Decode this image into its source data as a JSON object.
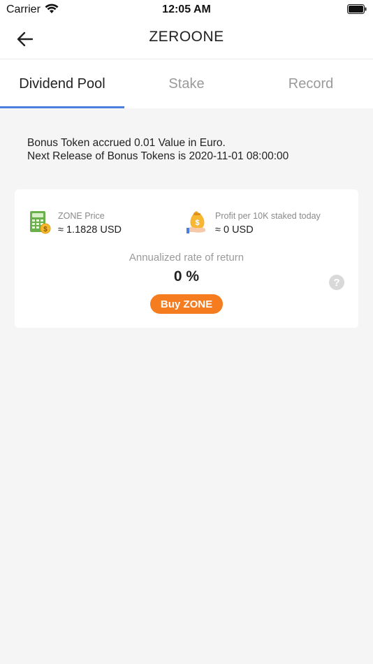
{
  "status_bar": {
    "carrier": "Carrier",
    "time": "12:05 AM"
  },
  "nav": {
    "title": "ZEROONE",
    "back_icon": "arrow-left-icon"
  },
  "tabs": [
    {
      "label": "Dividend Pool",
      "active": true
    },
    {
      "label": "Stake",
      "active": false
    },
    {
      "label": "Record",
      "active": false
    }
  ],
  "info": {
    "line1": "Bonus Token accrued 0.01 Value in Euro.",
    "line2": "Next Release of Bonus Tokens is 2020-11-01 08:00:00"
  },
  "card": {
    "price": {
      "label": "ZONE Price",
      "value": "≈ 1.1828 USD",
      "icon": "calculator-coin-icon"
    },
    "profit": {
      "label": "Profit per 10K staked today",
      "value": "≈ 0 USD",
      "icon": "money-bag-hand-icon"
    },
    "rate_label": "Annualized rate of return",
    "rate_value": "0 %",
    "help_icon": "question-icon",
    "buy_label": "Buy ZONE"
  },
  "colors": {
    "accent_blue": "#4a7fe0",
    "button_orange": "#f57c1f",
    "background": "#f5f5f5"
  }
}
